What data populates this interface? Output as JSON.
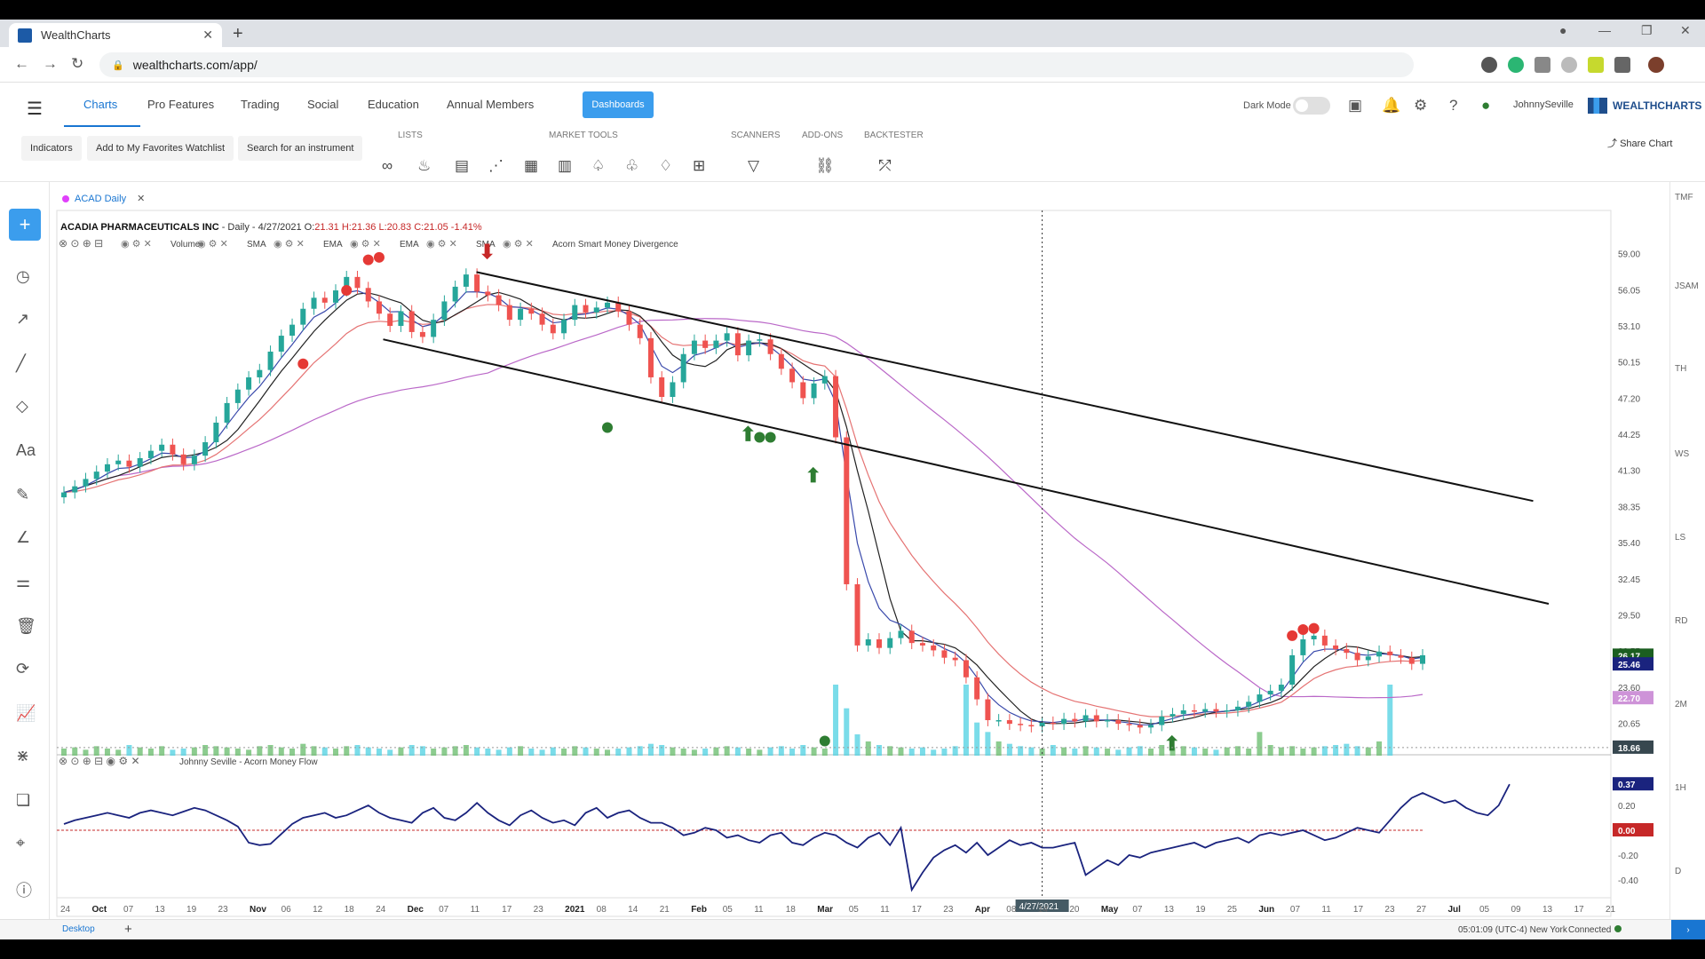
{
  "browser": {
    "tab_title": "WealthCharts",
    "url": "wealthcharts.com/app/"
  },
  "nav": {
    "items": [
      "Charts",
      "Pro Features",
      "Trading",
      "Social",
      "Education",
      "Annual Members"
    ],
    "dashboards": "Dashboards",
    "dark_mode": "Dark Mode",
    "username": "JohnnySeville",
    "logo": "WEALTHCHARTS"
  },
  "toolbar": {
    "indicators": "Indicators",
    "favorites": "Add to My Favorites Watchlist",
    "search": "Search for an instrument",
    "groups": [
      "LISTS",
      "MARKET TOOLS",
      "SCANNERS",
      "ADD-ONS",
      "BACKTESTER"
    ],
    "share": "Share Chart"
  },
  "chart_tab": "ACAD Daily",
  "ohlc": {
    "name": "ACADIA PHARMACEUTICALS INC",
    "detail": "- Daily - 4/27/2021 O:",
    "open": "21.31",
    "high": "H:21.36",
    "low": "L:20.83",
    "close": "C:21.05",
    "change": "-1.41%"
  },
  "indicator_labels": [
    "Volume",
    "SMA",
    "EMA",
    "EMA",
    "SMA",
    "Acorn Smart Money Divergence"
  ],
  "lower_indicator": "Johnny Seville - Acorn Money Flow",
  "price_ticks": [
    "59.00",
    "56.05",
    "53.10",
    "50.15",
    "47.20",
    "44.25",
    "41.30",
    "38.35",
    "35.40",
    "32.45",
    "29.50",
    "26.55",
    "23.60",
    "20.65"
  ],
  "price_badges": [
    {
      "text": "26.17",
      "color": "#1b5e20"
    },
    {
      "text": "25.46",
      "color": "#1a237e"
    },
    {
      "text": "22.70",
      "color": "#ce93d8"
    },
    {
      "text": "18.66",
      "color": "#37474f"
    }
  ],
  "osc_ticks": [
    "0.20",
    "-0.20",
    "-0.40"
  ],
  "osc_badges": [
    {
      "text": "0.37",
      "color": "#1a237e"
    },
    {
      "text": "0.00",
      "color": "#c62828"
    }
  ],
  "date_ticks": [
    "24",
    "Oct",
    "07",
    "13",
    "19",
    "23",
    "Nov",
    "06",
    "12",
    "18",
    "24",
    "Dec",
    "07",
    "11",
    "17",
    "23",
    "2021",
    "08",
    "14",
    "21",
    "Feb",
    "05",
    "11",
    "18",
    "Mar",
    "05",
    "11",
    "17",
    "23",
    "Apr",
    "08",
    "14",
    "20",
    "May",
    "07",
    "13",
    "19",
    "25",
    "Jun",
    "07",
    "11",
    "17",
    "23",
    "27",
    "Jul",
    "05",
    "09",
    "13",
    "17",
    "21"
  ],
  "cursor_date": "4/27/2021",
  "right_rail": [
    "TMF",
    "JSAM",
    "TH",
    "WS",
    "LS",
    "RD",
    "2M",
    "1H",
    "D"
  ],
  "footer": {
    "tab": "Desktop",
    "clock": "05:01:09",
    "tz": "(UTC-4) New York",
    "status": "Connected"
  },
  "chart_data": {
    "type": "candlestick",
    "ylim": [
      18.0,
      60.5
    ],
    "series": [
      {
        "name": "Close",
        "values": [
          39.5,
          40.0,
          40.6,
          41.2,
          41.8,
          42.1,
          41.6,
          42.3,
          42.9,
          43.4,
          42.6,
          41.8,
          42.5,
          43.6,
          45.2,
          46.8,
          47.9,
          48.9,
          49.5,
          51.0,
          52.3,
          53.2,
          54.5,
          55.4,
          55.0,
          56.0,
          57.1,
          56.2,
          55.1,
          54.1,
          53.1,
          54.3,
          52.6,
          52.2,
          53.6,
          55.1,
          56.3,
          57.3,
          55.9,
          55.6,
          54.8,
          53.6,
          54.5,
          54.1,
          53.2,
          52.5,
          53.6,
          54.8,
          54.2,
          54.6,
          55.0,
          54.3,
          53.2,
          52.1,
          48.9,
          47.3,
          48.5,
          50.8,
          51.9,
          51.3,
          51.9,
          52.5,
          50.7,
          51.9,
          52.0,
          50.8,
          49.6,
          48.5,
          47.2,
          48.4,
          49.0,
          44.0,
          32.0,
          27.0,
          27.5,
          26.8,
          27.6,
          28.2,
          27.2,
          27.0,
          26.6,
          26.0,
          25.8,
          24.4,
          22.6,
          20.9,
          20.9,
          20.6,
          20.5,
          20.4,
          20.7,
          20.6,
          21.0,
          20.8,
          21.3,
          20.8,
          20.9,
          20.6,
          20.5,
          20.3,
          20.5,
          21.2,
          21.4,
          21.7,
          21.6,
          21.8,
          21.6,
          21.7,
          22.0,
          22.4,
          23.0,
          23.3,
          23.8,
          26.2,
          27.5,
          27.8,
          27.0,
          26.7,
          26.4,
          25.8,
          26.1,
          26.5,
          26.2,
          26.0,
          25.5,
          26.2
        ]
      },
      {
        "name": "Volume",
        "values": [
          6,
          7,
          5,
          8,
          6,
          5,
          9,
          7,
          6,
          8,
          5,
          6,
          7,
          9,
          8,
          7,
          6,
          5,
          8,
          9,
          7,
          6,
          10,
          8,
          7,
          6,
          8,
          9,
          7,
          6,
          5,
          7,
          9,
          8,
          6,
          7,
          8,
          9,
          7,
          6,
          5,
          7,
          8,
          6,
          5,
          7,
          6,
          8,
          7,
          6,
          5,
          6,
          7,
          8,
          10,
          9,
          7,
          6,
          5,
          6,
          7,
          8,
          7,
          6,
          5,
          7,
          8,
          6,
          9,
          7,
          6,
          60,
          40,
          18,
          12,
          9,
          8,
          7,
          6,
          7,
          5,
          6,
          8,
          60,
          28,
          20,
          12,
          10,
          8,
          7,
          6,
          9,
          7,
          6,
          8,
          7,
          6,
          5,
          7,
          8,
          6,
          9,
          7,
          8,
          7,
          6,
          5,
          7,
          8,
          6,
          20,
          9,
          7,
          8,
          6,
          7,
          8,
          9,
          10,
          8,
          7,
          12,
          60
        ]
      },
      {
        "name": "Acorn Money Flow",
        "values": [
          0.05,
          0.08,
          0.1,
          0.12,
          0.14,
          0.12,
          0.1,
          0.14,
          0.16,
          0.14,
          0.12,
          0.15,
          0.18,
          0.16,
          0.12,
          0.08,
          0.03,
          -0.1,
          -0.12,
          -0.11,
          -0.03,
          0.05,
          0.1,
          0.12,
          0.14,
          0.1,
          0.12,
          0.16,
          0.2,
          0.14,
          0.1,
          0.08,
          0.06,
          0.14,
          0.18,
          0.1,
          0.08,
          0.14,
          0.22,
          0.14,
          0.08,
          0.04,
          0.12,
          0.16,
          0.1,
          0.06,
          0.08,
          0.04,
          0.14,
          0.18,
          0.1,
          0.14,
          0.16,
          0.1,
          0.06,
          0.06,
          0.02,
          -0.04,
          -0.02,
          0.02,
          0.0,
          -0.06,
          -0.04,
          -0.08,
          -0.1,
          -0.04,
          -0.02,
          -0.1,
          -0.12,
          -0.06,
          -0.02,
          -0.04,
          -0.1,
          -0.14,
          -0.06,
          -0.02,
          -0.12,
          0.02,
          -0.48,
          -0.34,
          -0.22,
          -0.16,
          -0.12,
          -0.18,
          -0.1,
          -0.2,
          -0.14,
          -0.08,
          -0.12,
          -0.1,
          -0.14,
          -0.14,
          -0.12,
          -0.1,
          -0.36,
          -0.3,
          -0.24,
          -0.28,
          -0.2,
          -0.22,
          -0.18,
          -0.16,
          -0.14,
          -0.12,
          -0.1,
          -0.14,
          -0.1,
          -0.08,
          -0.06,
          -0.1,
          -0.04,
          -0.02,
          -0.04,
          -0.02,
          0.0,
          -0.04,
          -0.08,
          -0.06,
          -0.02,
          0.02,
          0.0,
          -0.02,
          0.08,
          0.18,
          0.26,
          0.3,
          0.26,
          0.22,
          0.24,
          0.18,
          0.14,
          0.12,
          0.2,
          0.37
        ]
      }
    ],
    "trendlines": [
      {
        "name": "upper-channel",
        "from": [
          0.27,
          57.5
        ],
        "to": [
          0.95,
          38.8
        ]
      },
      {
        "name": "lower-channel",
        "from": [
          0.21,
          52.0
        ],
        "to": [
          0.96,
          30.4
        ]
      }
    ]
  }
}
